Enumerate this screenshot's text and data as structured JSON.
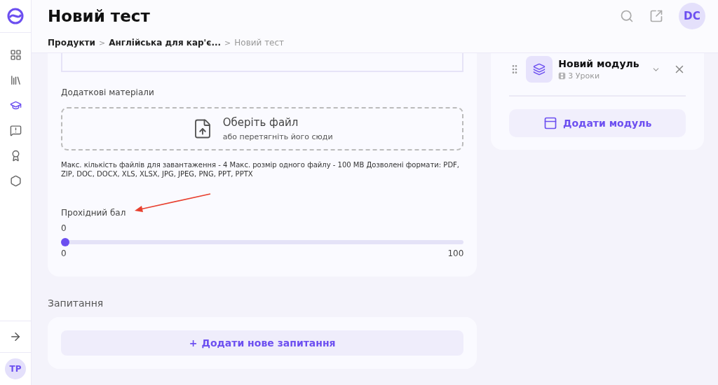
{
  "header": {
    "title": "Новий тест",
    "avatar": "DC"
  },
  "breadcrumb": [
    {
      "label": "Продукти",
      "current": false
    },
    {
      "label": "Англійська для кар'є...",
      "current": false
    },
    {
      "label": "Новий тест",
      "current": true
    }
  ],
  "breadcrumb_separator": ">",
  "sidebar": {
    "items": [
      {
        "selected": false
      },
      {
        "selected": false
      },
      {
        "selected": true
      },
      {
        "selected": false
      },
      {
        "selected": false
      },
      {
        "selected": false
      }
    ],
    "avatar": "TP"
  },
  "materials": {
    "label": "Додаткові матеріали",
    "drop_title": "Оберіть файл",
    "drop_hint": "або перетягніть його сюди",
    "note": "Макс. кількість файлів для завантаження - 4 Макс. розмір одного файлу - 100 MB Дозволені формати: PDF, ZIP, DOC, DOCX, XLS, XLSX, JPG, JPEG, PNG, PPT, PPTX"
  },
  "passing_score": {
    "label": "Прохідний бал",
    "value": "0",
    "level": 0,
    "min": "0",
    "max": "100"
  },
  "questions": {
    "title": "Запитання",
    "add_button": "Додати нове запитання",
    "add_icon": "+"
  },
  "modules": [
    {
      "title": "Новий модуль",
      "lessons": "3 Уроки"
    }
  ],
  "add_module_button": "Додати модуль"
}
